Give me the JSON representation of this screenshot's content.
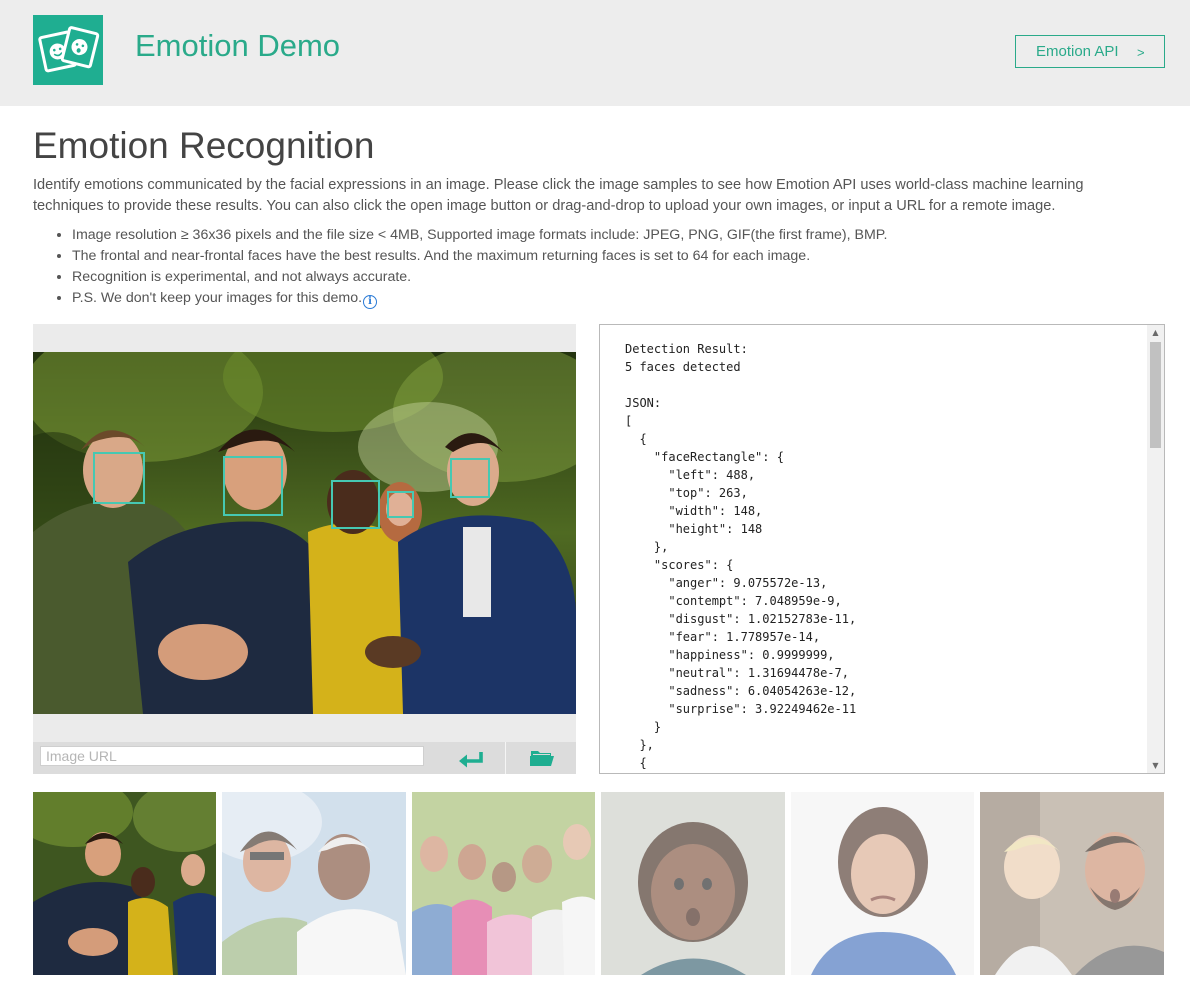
{
  "header": {
    "app_title": "Emotion Demo",
    "api_button_label": "Emotion API",
    "api_button_chevron": ">",
    "logo_icon": "emotion-faces-icon"
  },
  "main": {
    "title": "Emotion Recognition",
    "intro": "Identify emotions communicated by the facial expressions in an image. Please click the image samples to see how Emotion API uses world-class machine learning techniques to provide these results. You can also click the open image button or drag-and-drop to upload your own images, or input a URL for a remote image.",
    "bullets": [
      "Image resolution ≥ 36x36 pixels and the file size < 4MB, Supported image formats include: JPEG, PNG, GIF(the first frame), BMP.",
      "The frontal and near-frontal faces have the best results. And the maximum returning faces is set to 64 for each image.",
      "Recognition is experimental, and not always accurate.",
      "P.S. We don't keep your images for this demo."
    ],
    "info_icon": "i"
  },
  "image_panel": {
    "url_placeholder": "Image URL",
    "enter_icon": "enter-arrow-icon",
    "open_icon": "open-folder-icon",
    "accent_color": "#1fae91"
  },
  "result": {
    "text": "Detection Result:\n5 faces detected\n\nJSON:\n[\n  {\n    \"faceRectangle\": {\n      \"left\": 488,\n      \"top\": 263,\n      \"width\": 148,\n      \"height\": 148\n    },\n    \"scores\": {\n      \"anger\": 9.075572e-13,\n      \"contempt\": 7.048959e-9,\n      \"disgust\": 1.02152783e-11,\n      \"fear\": 1.778957e-14,\n      \"happiness\": 0.9999999,\n      \"neutral\": 1.31694478e-7,\n      \"sadness\": 6.04054263e-12,\n      \"surprise\": 3.92249462e-11\n    }\n  },\n  {"
  },
  "samples": [
    {
      "name": "sample-group-friends",
      "selected": true
    },
    {
      "name": "sample-elderly-couple",
      "selected": false
    },
    {
      "name": "sample-family",
      "selected": false
    },
    {
      "name": "sample-surprised-child",
      "selected": false
    },
    {
      "name": "sample-disgusted-woman",
      "selected": false
    },
    {
      "name": "sample-man-and-baby",
      "selected": false
    }
  ],
  "colors": {
    "accent": "#2aaa8a",
    "header_bg": "#ededed",
    "face_box": "#46c8b2"
  }
}
